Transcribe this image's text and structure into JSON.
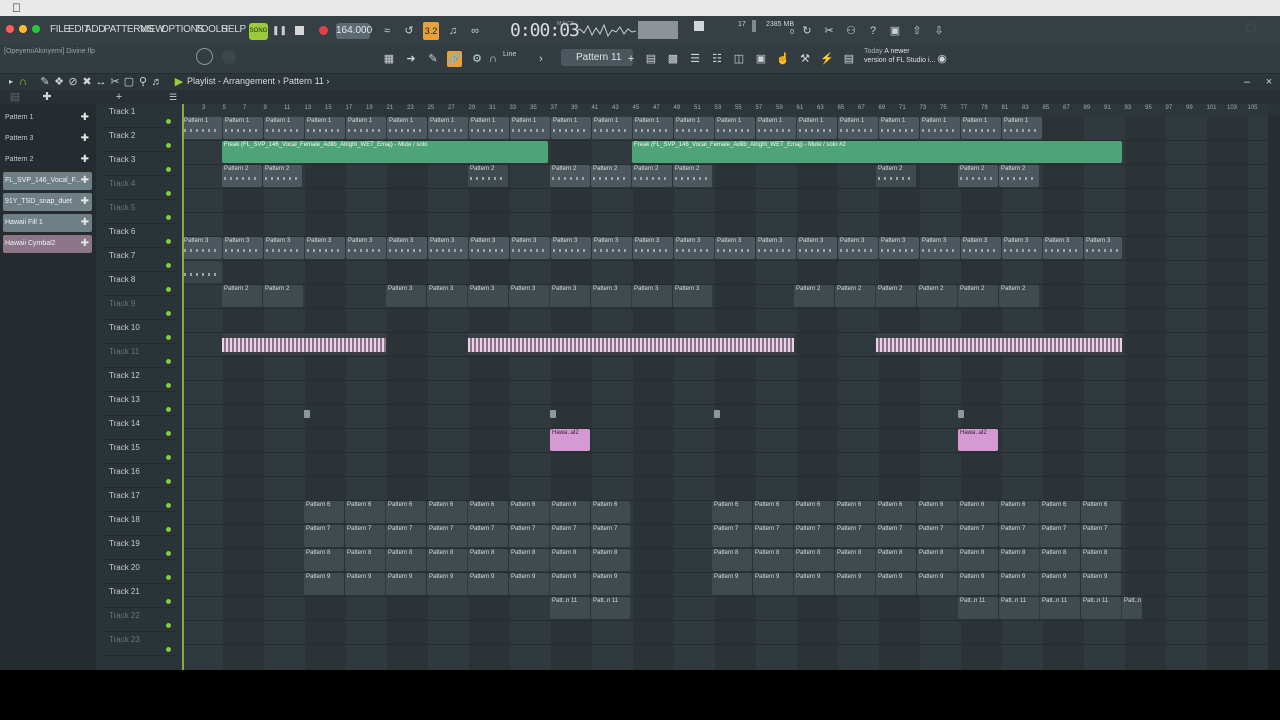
{
  "menu": [
    "FILE",
    "EDIT",
    "ADD",
    "PATTERNS",
    "VIEW",
    "OPTIONS",
    "TOOLS",
    "HELP"
  ],
  "transport": {
    "mode_label": "SONG",
    "tempo": "164.000",
    "time": "0:00",
    "time_sub": "03",
    "time_unit": "M:S:CS",
    "metronome": "3.2"
  },
  "monitor": {
    "cpu": "17",
    "memory": "2385 MB",
    "voices": "0"
  },
  "project": {
    "author": "[OpeyemiAkinyemi]",
    "filename": "Divine.flp"
  },
  "toolbar": {
    "snap": "Line",
    "pattern": "Pattern 11"
  },
  "news": {
    "line1_prefix": "Today",
    "line1": "A newer",
    "line2": "version of FL Studio i..."
  },
  "playlist": {
    "title": "Playlist - Arrangement",
    "crumb": "Pattern 11"
  },
  "browser": {
    "items": [
      {
        "label": "Pattern 1",
        "kind": "pattern"
      },
      {
        "label": "Pattern 3",
        "kind": "pattern"
      },
      {
        "label": "Pattern 2",
        "kind": "pattern"
      },
      {
        "label": "FL_SVP_146_Vocal_F...",
        "kind": "audio"
      },
      {
        "label": "91Y_TSD_snap_duet",
        "kind": "audio"
      },
      {
        "label": "Hawaii Fill 1",
        "kind": "audio"
      },
      {
        "label": "Hawaii Cymbal2",
        "kind": "audio-pink"
      }
    ]
  },
  "ruler": [
    "3",
    "5",
    "7",
    "9",
    "11",
    "13",
    "15",
    "17",
    "19",
    "21",
    "23",
    "25",
    "27",
    "29",
    "31",
    "33",
    "35",
    "37",
    "39",
    "41",
    "43",
    "45",
    "47",
    "49",
    "51",
    "53",
    "55",
    "57",
    "59",
    "61",
    "63",
    "65",
    "67",
    "69",
    "71",
    "73",
    "75",
    "77",
    "79",
    "81",
    "83",
    "85",
    "87",
    "89",
    "91",
    "93",
    "95",
    "97",
    "99",
    "101",
    "103",
    "105"
  ],
  "tracks": [
    {
      "name": "Track 1",
      "dim": false
    },
    {
      "name": "Track 2",
      "dim": false
    },
    {
      "name": "Track 3",
      "dim": false
    },
    {
      "name": "Track 4",
      "dim": true
    },
    {
      "name": "Track 5",
      "dim": true
    },
    {
      "name": "Track 6",
      "dim": false
    },
    {
      "name": "Track 7",
      "dim": false
    },
    {
      "name": "Track 8",
      "dim": false
    },
    {
      "name": "Track 9",
      "dim": true
    },
    {
      "name": "Track 10",
      "dim": false
    },
    {
      "name": "Track 11",
      "dim": true
    },
    {
      "name": "Track 12",
      "dim": false
    },
    {
      "name": "Track 13",
      "dim": false
    },
    {
      "name": "Track 14",
      "dim": false
    },
    {
      "name": "Track 15",
      "dim": false
    },
    {
      "name": "Track 16",
      "dim": false
    },
    {
      "name": "Track 17",
      "dim": false
    },
    {
      "name": "Track 18",
      "dim": false
    },
    {
      "name": "Track 19",
      "dim": false
    },
    {
      "name": "Track 20",
      "dim": false
    },
    {
      "name": "Track 21",
      "dim": false
    },
    {
      "name": "Track 22",
      "dim": true
    },
    {
      "name": "Track 23",
      "dim": true
    }
  ],
  "clips": {
    "vocal_a": "Freak (FL_SVP_146_Vocal_Female_Adlib_Alright_WET_Emaj) - Mute / solo",
    "vocal_b": "Freak (FL_SVP_146_Vocal_Female_Adlib_Alright_WET_Emaj) - Mute / solo #2",
    "p1": "Pattern 1",
    "p1s": "Pat..n 1",
    "p2": "Pattern 2",
    "p2s": "Pat..n 2",
    "p3": "Pattern 3",
    "p3s": "Pat..n 3",
    "p6": "Pattern 6",
    "p6s": "Pat..rn 6",
    "p7": "Pattern 7",
    "p7s": "Pat..rn 7",
    "p8": "Pattern 8",
    "p8s": "Pat..rn 8",
    "p9": "Pattern 9",
    "p9s": "Pat..n 9",
    "p11": "Patt..n 11",
    "p11b": "Pattern 11",
    "hawaii": "Hawa..al2"
  }
}
